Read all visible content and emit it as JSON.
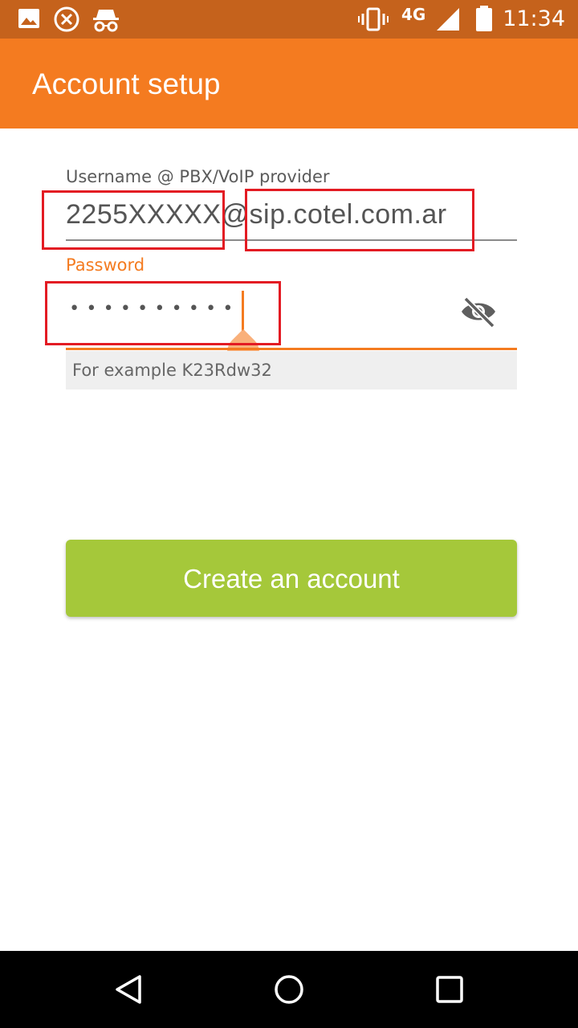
{
  "status_bar": {
    "time": "11:34",
    "network": "4G",
    "icons": [
      "image-icon",
      "close-circle-icon",
      "incognito-icon",
      "vibrate-icon",
      "signal-icon",
      "battery-icon"
    ]
  },
  "app_bar": {
    "title": "Account setup"
  },
  "form": {
    "username_label": "Username @ PBX/VoIP provider",
    "username_value": "2255XXXXX@sip.cotel.com.ar",
    "password_label": "Password",
    "password_value": "••••••••••",
    "password_hint": "For example K23Rdw32",
    "visibility_icon": "eye-off-icon"
  },
  "create_button": {
    "label": "Create an account"
  },
  "navigation": {
    "icons": [
      "back-icon",
      "home-icon",
      "recents-icon"
    ]
  },
  "colors": {
    "status_bar": "#c5621c",
    "app_bar": "#f47b20",
    "accent": "#f47b20",
    "button": "#a5c83a",
    "annotation": "#e31b23"
  }
}
